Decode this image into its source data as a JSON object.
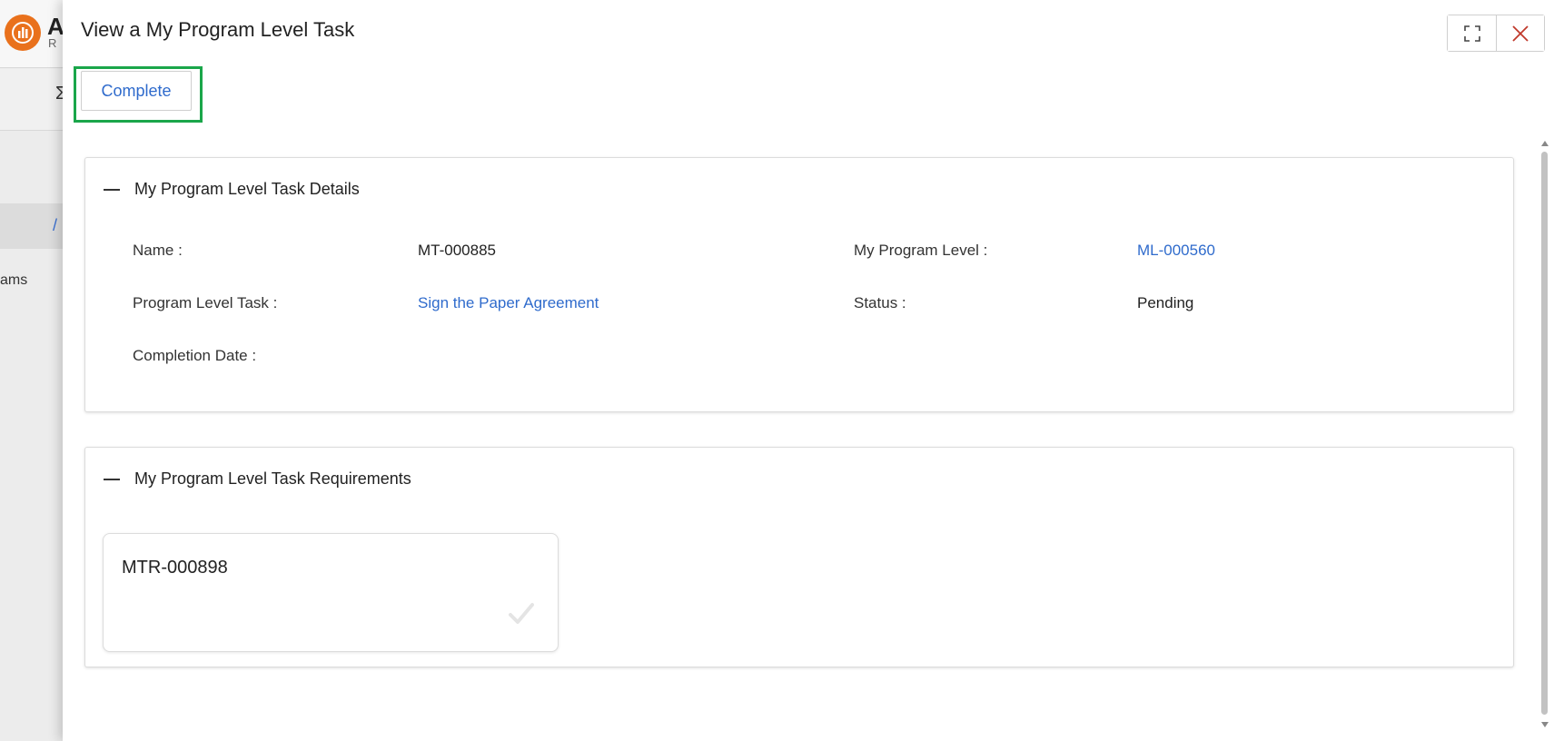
{
  "background_app": {
    "brand_initial": "A",
    "brand_sub": "R",
    "toolbar_symbol": "Σ",
    "nav_active_mark": "/",
    "nav_item_fragment": "ams",
    "logo_color": "#e9711c"
  },
  "modal": {
    "title": "View a My Program Level Task",
    "controls": {
      "expand_icon": "expand-icon",
      "close_icon": "close-icon",
      "close_color": "#c0392b"
    },
    "actions": {
      "complete_label": "Complete",
      "highlight_color": "#1aa64a"
    },
    "details_section": {
      "title": "My Program Level Task Details",
      "fields": {
        "name_label": "Name :",
        "name_value": "MT-000885",
        "program_level_label": "My Program Level :",
        "program_level_value": "ML-000560",
        "program_level_task_label": "Program Level Task :",
        "program_level_task_value": "Sign the Paper Agreement",
        "status_label": "Status :",
        "status_value": "Pending",
        "completion_date_label": "Completion Date :",
        "completion_date_value": ""
      }
    },
    "requirements_section": {
      "title": "My Program Level Task Requirements",
      "cards": [
        {
          "id": "MTR-000898",
          "icon": "checkmark-icon"
        }
      ]
    },
    "link_color": "#2f6bcc"
  }
}
